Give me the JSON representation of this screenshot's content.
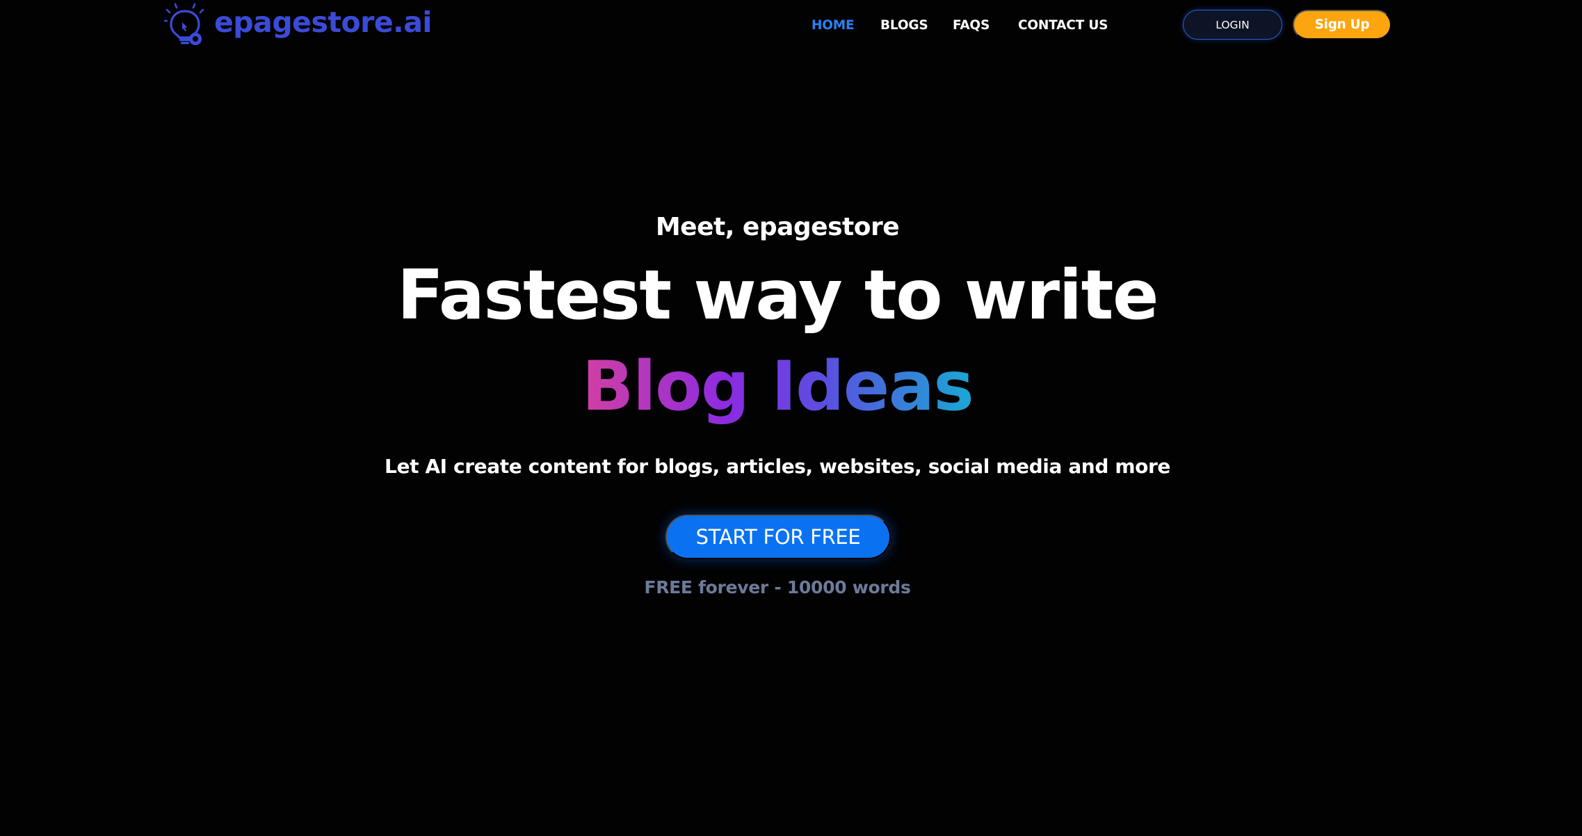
{
  "colors": {
    "background": "#000000",
    "brand": "#3b4bd8",
    "nav_active": "#2d7ff0",
    "login_border": "#2c5fd0",
    "signup_bg": "#fda50f",
    "cta_bg": "#0a72f0",
    "note_text": "#6d7b99",
    "gradient": [
      "#d23fa3",
      "#8a2be2",
      "#5a4fe0",
      "#1aa8d4"
    ]
  },
  "header": {
    "brand_icon": "lightbulb-icon",
    "brand_name": "epagestore.ai",
    "nav": {
      "home": "HOME",
      "blogs": "BLOGS",
      "faqs": "FAQS",
      "contact": "CONTACT US"
    },
    "active_nav": "home",
    "login_label": "LOGIN",
    "signup_label": "Sign Up"
  },
  "hero": {
    "eyebrow": "Meet, epagestore",
    "title": "Fastest way to write",
    "highlight": "Blog Ideas",
    "subtitle": "Let AI create content for blogs, articles, websites, social media and more",
    "cta_label": "START FOR FREE",
    "note": "FREE forever - 10000 words"
  }
}
